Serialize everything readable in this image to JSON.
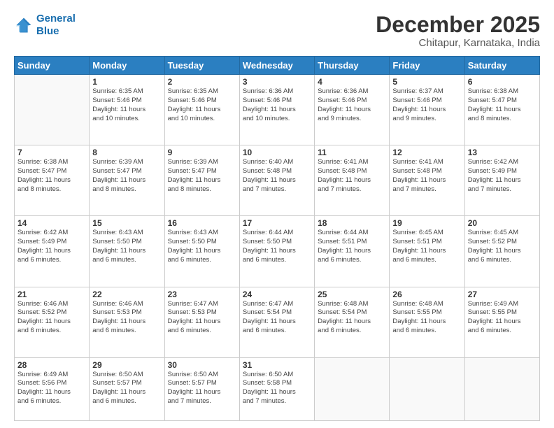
{
  "logo": {
    "line1": "General",
    "line2": "Blue"
  },
  "title": "December 2025",
  "subtitle": "Chitapur, Karnataka, India",
  "weekdays": [
    "Sunday",
    "Monday",
    "Tuesday",
    "Wednesday",
    "Thursday",
    "Friday",
    "Saturday"
  ],
  "weeks": [
    [
      {
        "day": "",
        "info": ""
      },
      {
        "day": "1",
        "info": "Sunrise: 6:35 AM\nSunset: 5:46 PM\nDaylight: 11 hours\nand 10 minutes."
      },
      {
        "day": "2",
        "info": "Sunrise: 6:35 AM\nSunset: 5:46 PM\nDaylight: 11 hours\nand 10 minutes."
      },
      {
        "day": "3",
        "info": "Sunrise: 6:36 AM\nSunset: 5:46 PM\nDaylight: 11 hours\nand 10 minutes."
      },
      {
        "day": "4",
        "info": "Sunrise: 6:36 AM\nSunset: 5:46 PM\nDaylight: 11 hours\nand 9 minutes."
      },
      {
        "day": "5",
        "info": "Sunrise: 6:37 AM\nSunset: 5:46 PM\nDaylight: 11 hours\nand 9 minutes."
      },
      {
        "day": "6",
        "info": "Sunrise: 6:38 AM\nSunset: 5:47 PM\nDaylight: 11 hours\nand 8 minutes."
      }
    ],
    [
      {
        "day": "7",
        "info": "Sunrise: 6:38 AM\nSunset: 5:47 PM\nDaylight: 11 hours\nand 8 minutes."
      },
      {
        "day": "8",
        "info": "Sunrise: 6:39 AM\nSunset: 5:47 PM\nDaylight: 11 hours\nand 8 minutes."
      },
      {
        "day": "9",
        "info": "Sunrise: 6:39 AM\nSunset: 5:47 PM\nDaylight: 11 hours\nand 8 minutes."
      },
      {
        "day": "10",
        "info": "Sunrise: 6:40 AM\nSunset: 5:48 PM\nDaylight: 11 hours\nand 7 minutes."
      },
      {
        "day": "11",
        "info": "Sunrise: 6:41 AM\nSunset: 5:48 PM\nDaylight: 11 hours\nand 7 minutes."
      },
      {
        "day": "12",
        "info": "Sunrise: 6:41 AM\nSunset: 5:48 PM\nDaylight: 11 hours\nand 7 minutes."
      },
      {
        "day": "13",
        "info": "Sunrise: 6:42 AM\nSunset: 5:49 PM\nDaylight: 11 hours\nand 7 minutes."
      }
    ],
    [
      {
        "day": "14",
        "info": "Sunrise: 6:42 AM\nSunset: 5:49 PM\nDaylight: 11 hours\nand 6 minutes."
      },
      {
        "day": "15",
        "info": "Sunrise: 6:43 AM\nSunset: 5:50 PM\nDaylight: 11 hours\nand 6 minutes."
      },
      {
        "day": "16",
        "info": "Sunrise: 6:43 AM\nSunset: 5:50 PM\nDaylight: 11 hours\nand 6 minutes."
      },
      {
        "day": "17",
        "info": "Sunrise: 6:44 AM\nSunset: 5:50 PM\nDaylight: 11 hours\nand 6 minutes."
      },
      {
        "day": "18",
        "info": "Sunrise: 6:44 AM\nSunset: 5:51 PM\nDaylight: 11 hours\nand 6 minutes."
      },
      {
        "day": "19",
        "info": "Sunrise: 6:45 AM\nSunset: 5:51 PM\nDaylight: 11 hours\nand 6 minutes."
      },
      {
        "day": "20",
        "info": "Sunrise: 6:45 AM\nSunset: 5:52 PM\nDaylight: 11 hours\nand 6 minutes."
      }
    ],
    [
      {
        "day": "21",
        "info": "Sunrise: 6:46 AM\nSunset: 5:52 PM\nDaylight: 11 hours\nand 6 minutes."
      },
      {
        "day": "22",
        "info": "Sunrise: 6:46 AM\nSunset: 5:53 PM\nDaylight: 11 hours\nand 6 minutes."
      },
      {
        "day": "23",
        "info": "Sunrise: 6:47 AM\nSunset: 5:53 PM\nDaylight: 11 hours\nand 6 minutes."
      },
      {
        "day": "24",
        "info": "Sunrise: 6:47 AM\nSunset: 5:54 PM\nDaylight: 11 hours\nand 6 minutes."
      },
      {
        "day": "25",
        "info": "Sunrise: 6:48 AM\nSunset: 5:54 PM\nDaylight: 11 hours\nand 6 minutes."
      },
      {
        "day": "26",
        "info": "Sunrise: 6:48 AM\nSunset: 5:55 PM\nDaylight: 11 hours\nand 6 minutes."
      },
      {
        "day": "27",
        "info": "Sunrise: 6:49 AM\nSunset: 5:55 PM\nDaylight: 11 hours\nand 6 minutes."
      }
    ],
    [
      {
        "day": "28",
        "info": "Sunrise: 6:49 AM\nSunset: 5:56 PM\nDaylight: 11 hours\nand 6 minutes."
      },
      {
        "day": "29",
        "info": "Sunrise: 6:50 AM\nSunset: 5:57 PM\nDaylight: 11 hours\nand 6 minutes."
      },
      {
        "day": "30",
        "info": "Sunrise: 6:50 AM\nSunset: 5:57 PM\nDaylight: 11 hours\nand 7 minutes."
      },
      {
        "day": "31",
        "info": "Sunrise: 6:50 AM\nSunset: 5:58 PM\nDaylight: 11 hours\nand 7 minutes."
      },
      {
        "day": "",
        "info": ""
      },
      {
        "day": "",
        "info": ""
      },
      {
        "day": "",
        "info": ""
      }
    ]
  ]
}
